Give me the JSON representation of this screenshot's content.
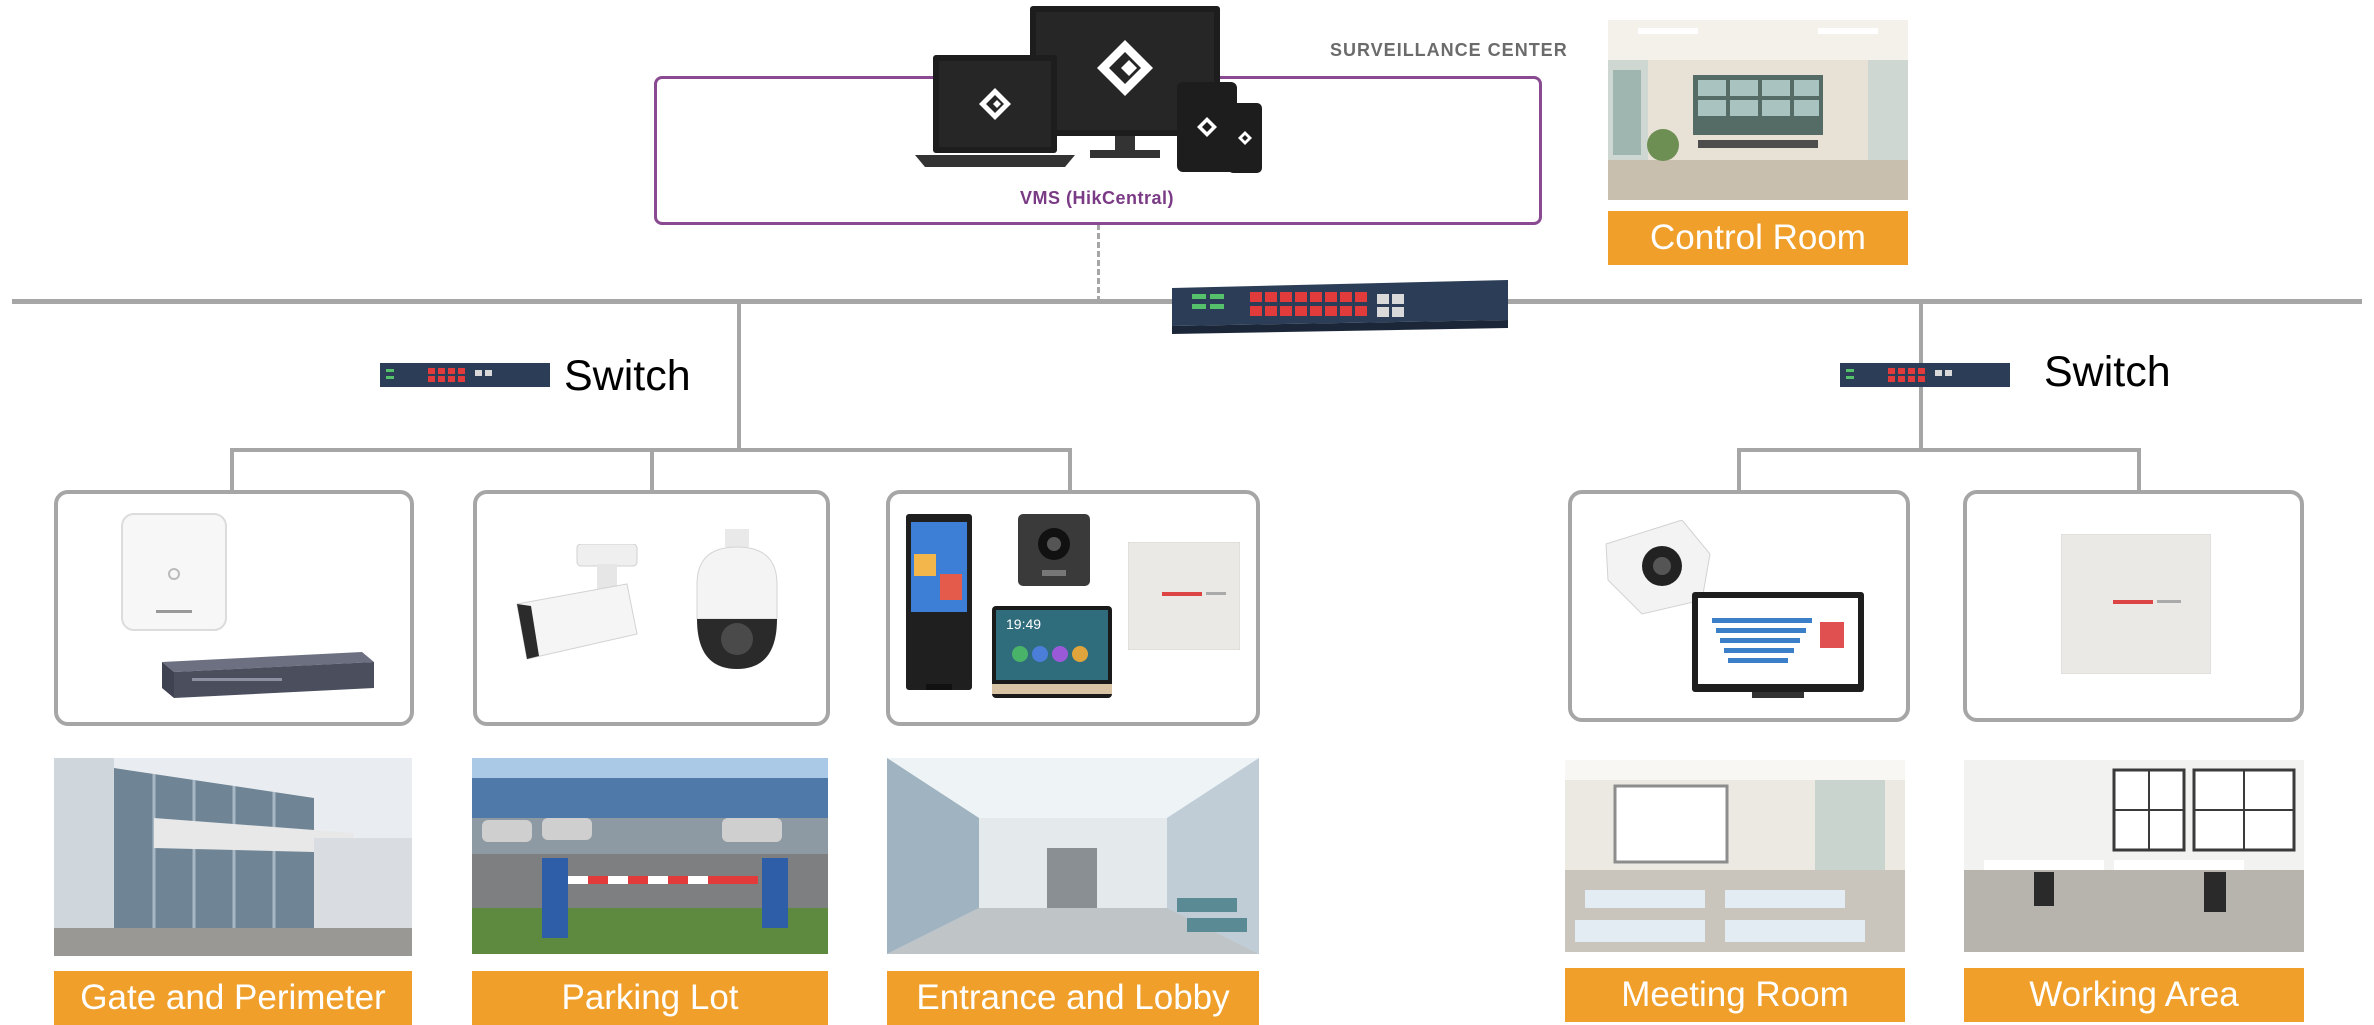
{
  "surveillance_center": {
    "caption": "SURVEILLANCE CENTER",
    "vms_label": "VMS (HikCentral)"
  },
  "control_room": {
    "label": "Control Room"
  },
  "switches": {
    "left_label": "Switch",
    "right_label": "Switch"
  },
  "areas": [
    {
      "label": "Gate and Perimeter"
    },
    {
      "label": "Parking Lot"
    },
    {
      "label": "Entrance and Lobby"
    },
    {
      "label": "Meeting Room"
    },
    {
      "label": "Working Area"
    }
  ],
  "devices": {
    "intercom_screen_time": "19:49"
  },
  "colors": {
    "label_orange": "#f0a02a",
    "line_gray": "#a6a6a6",
    "vms_purple": "#8a4a92"
  }
}
